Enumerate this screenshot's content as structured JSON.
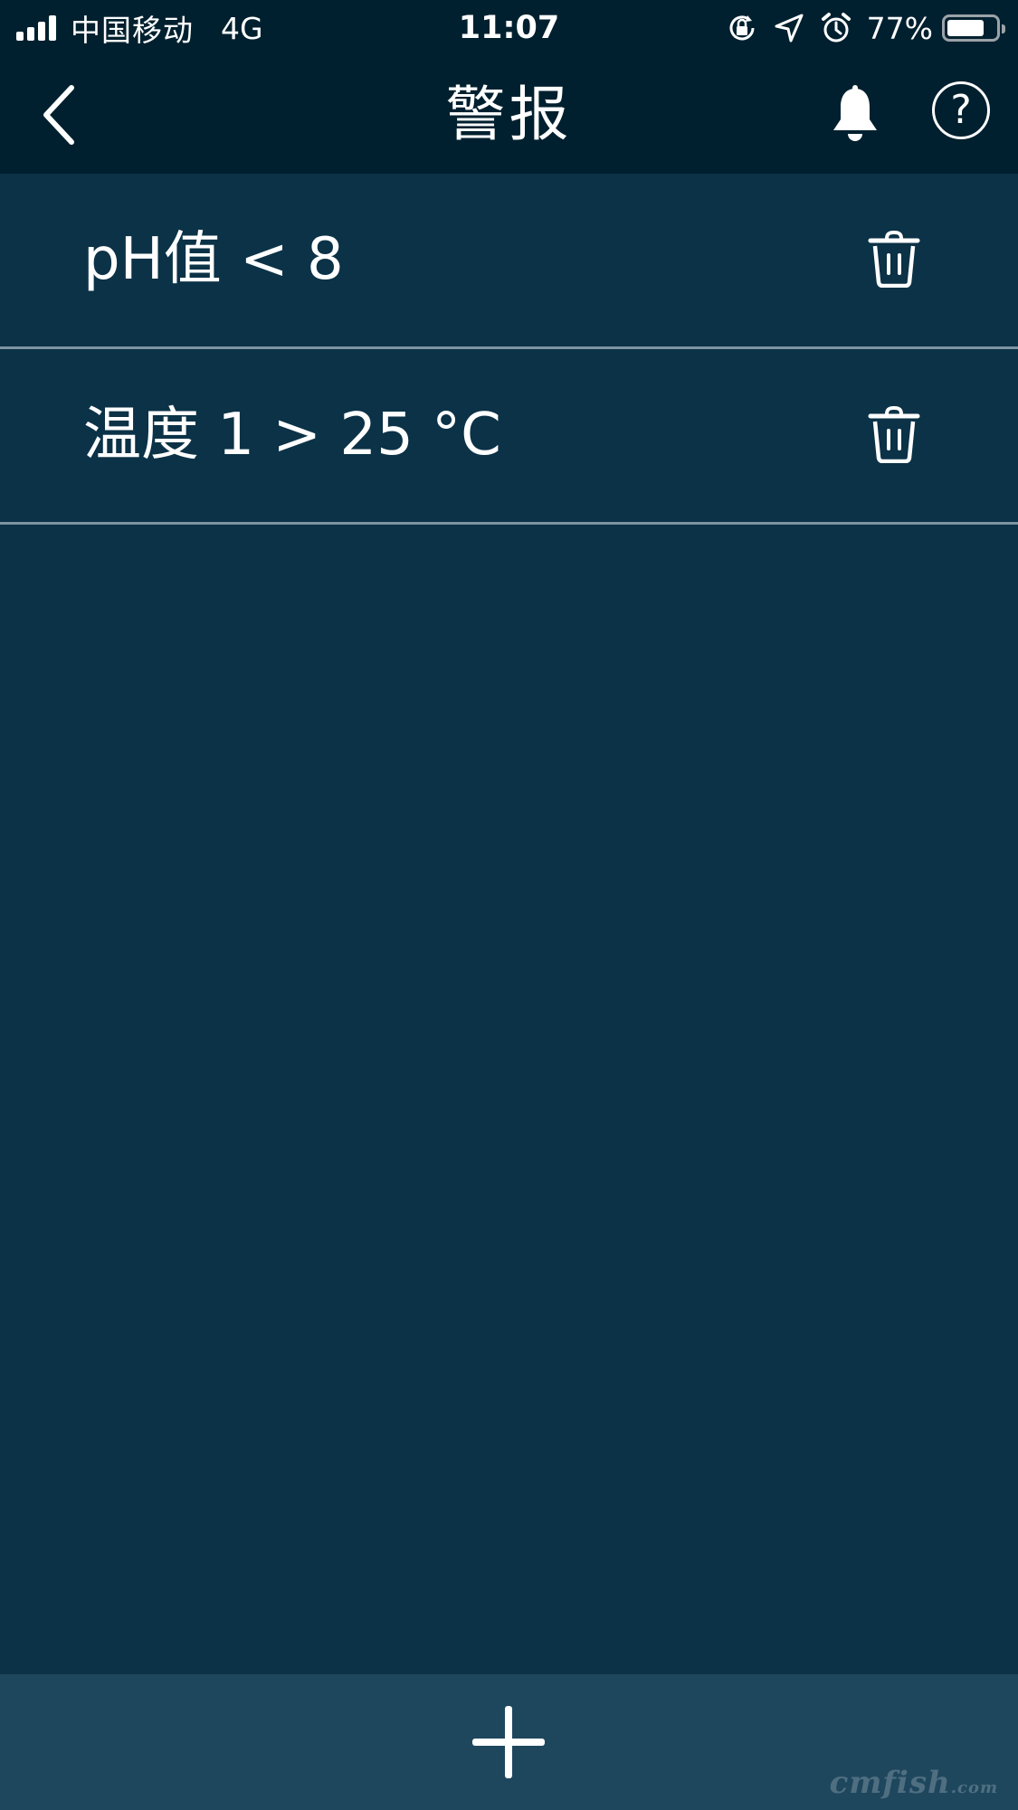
{
  "status_bar": {
    "carrier": "中国移动",
    "network": "4G",
    "time": "11:07",
    "battery_percent": "77%",
    "battery_level": 0.77,
    "icons": [
      "signal-icon",
      "rotation-lock-icon",
      "location-icon",
      "alarm-icon",
      "battery-icon"
    ]
  },
  "nav": {
    "title": "警报",
    "icons": [
      "back-chevron-icon",
      "bell-icon",
      "help-icon"
    ],
    "help_glyph": "?"
  },
  "alerts": [
    {
      "text": "pH值 < 8",
      "action_icon": "trash-icon"
    },
    {
      "text": "温度 1 > 25 °C",
      "action_icon": "trash-icon"
    }
  ],
  "bottom_bar": {
    "action_icon": "plus-icon",
    "watermark_main": "cmfish",
    "watermark_suffix": ".com"
  },
  "colors": {
    "header_bg": "#00202f",
    "content_bg": "#0b3247",
    "bottom_bar_bg": "#1e475e",
    "divider": "#7e95a2",
    "foreground": "#ffffff"
  }
}
